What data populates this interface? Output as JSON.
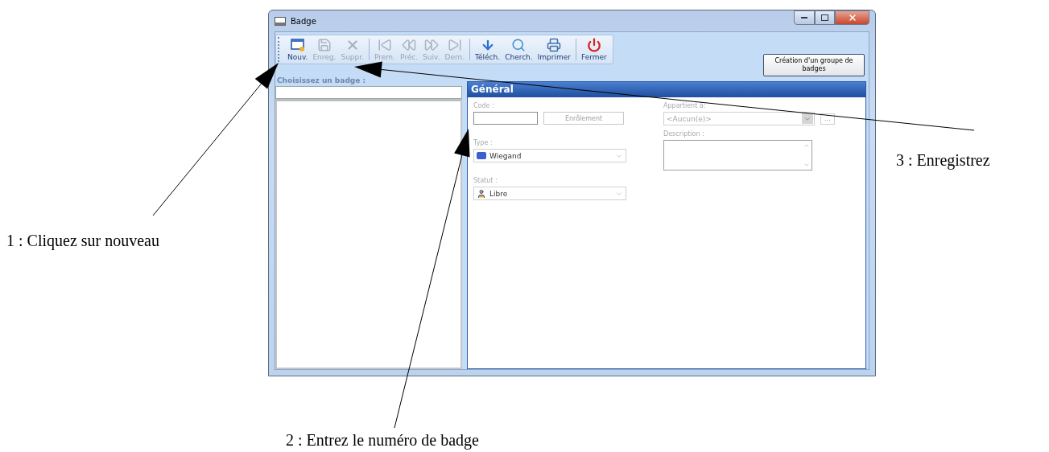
{
  "window": {
    "title": "Badge"
  },
  "toolbar": {
    "groups": [
      [
        {
          "label": "Nouv.",
          "disabled": false
        },
        {
          "label": "Enreg.",
          "disabled": true
        },
        {
          "label": "Suppr.",
          "disabled": true
        }
      ],
      [
        {
          "label": "Prem.",
          "disabled": true
        },
        {
          "label": "Préc.",
          "disabled": true
        },
        {
          "label": "Suiv.",
          "disabled": true
        },
        {
          "label": "Dern.",
          "disabled": true
        }
      ],
      [
        {
          "label": "Téléch.",
          "disabled": false
        },
        {
          "label": "Cherch.",
          "disabled": false
        },
        {
          "label": "Imprimer",
          "disabled": false
        }
      ],
      [
        {
          "label": "Fermer",
          "disabled": false
        }
      ]
    ]
  },
  "group_button": "Création d'un groupe de badges",
  "badge_list": {
    "label": "Choisissez un badge :"
  },
  "general": {
    "title": "Général",
    "code": {
      "label": "Code :",
      "button": "Enrôlement"
    },
    "type": {
      "label": "Type :",
      "value": "Wiegand"
    },
    "status": {
      "label": "Statut :",
      "value": "Libre"
    },
    "owner": {
      "label": "Appartient à:",
      "value": "<Aucun(e)>",
      "button": "..."
    },
    "description": {
      "label": "Description :"
    }
  },
  "annotations": [
    {
      "text": "1 : Cliquez sur nouveau"
    },
    {
      "text": "2 : Entrez le numéro de badge"
    },
    {
      "text": "3 : Enregistrez"
    }
  ]
}
